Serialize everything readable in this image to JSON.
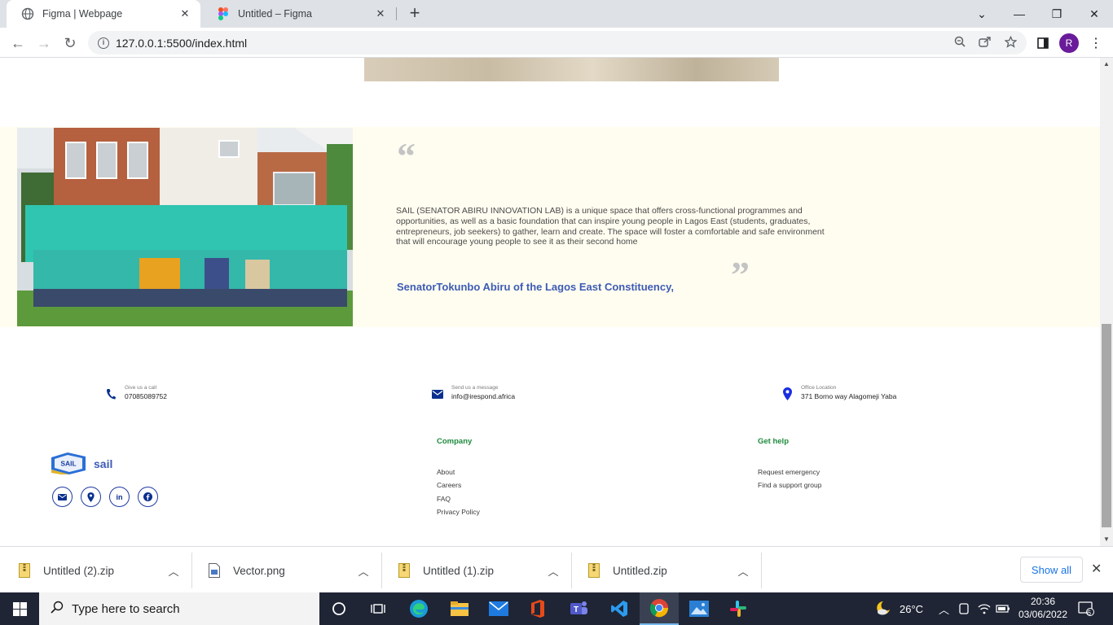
{
  "browser": {
    "tabs": [
      {
        "title": "Figma | Webpage",
        "active": true
      },
      {
        "title": "Untitled – Figma",
        "active": false
      }
    ],
    "url": "127.0.0.1:5500/index.html",
    "profile_initial": "R"
  },
  "page": {
    "quote": {
      "text": "SAIL (SENATOR ABIRU INNOVATION LAB) is a unique space that offers cross-functional programmes and opportunities, as well as a basic foundation that can inspire young people in Lagos East (students, graduates, entrepreneurs, job seekers) to gather, learn and create. The space will foster a comfortable and safe environment that will encourage young people to see it as their second home",
      "author": "SenatorTokunbo Abiru of the Lagos East Constituency,"
    },
    "contacts": [
      {
        "label": "Give us a call",
        "value": "07085089752",
        "icon": "phone-icon"
      },
      {
        "label": "Send us a message",
        "value": "info@irespond.africa",
        "icon": "mail-icon"
      },
      {
        "label": "Office Location",
        "value": "371 Borno way Alagomeji Yaba",
        "icon": "location-icon"
      }
    ],
    "brand": {
      "logo_text": "SAIL",
      "name": "sail"
    },
    "company": {
      "title": "Company",
      "links": [
        "About",
        "Careers",
        "FAQ",
        "Privacy Policy"
      ]
    },
    "help": {
      "title": "Get help",
      "links": [
        "Request emergency",
        "Find a support group"
      ]
    },
    "colors": {
      "accent_blue": "#3d5bb5",
      "green_heading": "#1e8a3c",
      "quote_bg": "#fffdf0"
    }
  },
  "downloads": {
    "items": [
      "Untitled (2).zip",
      "Vector.png",
      "Untitled (1).zip",
      "Untitled.zip"
    ],
    "show_all": "Show all"
  },
  "taskbar": {
    "search_placeholder": "Type here to search",
    "weather": "26°C",
    "time": "20:36",
    "date": "03/06/2022",
    "notifications": "6"
  }
}
